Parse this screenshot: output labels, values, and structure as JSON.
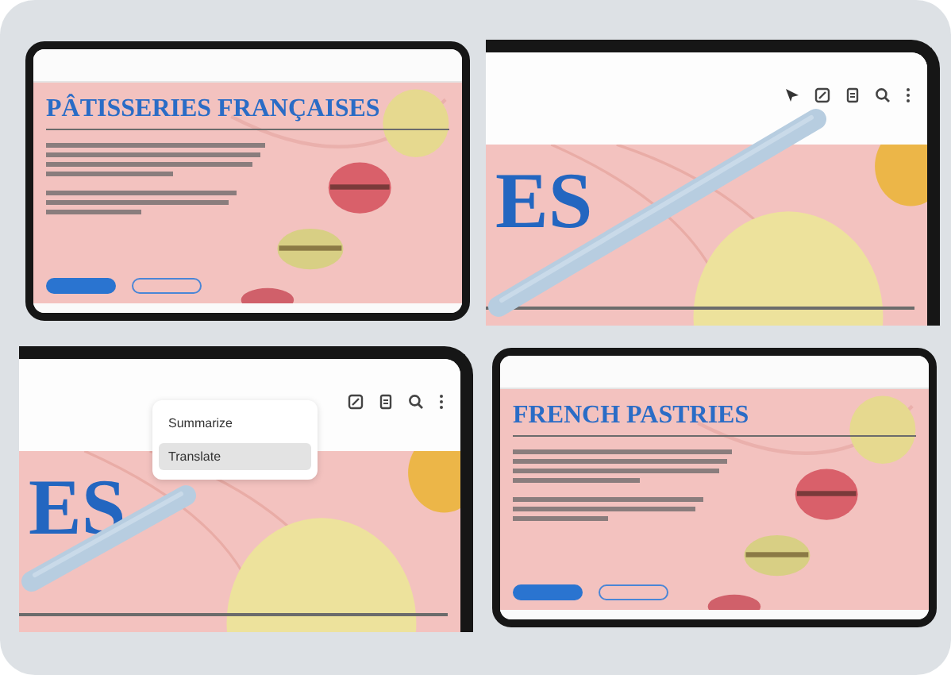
{
  "panels": [
    {
      "kind": "tablet",
      "title": "PÂTISSERIES FRANÇAISES"
    },
    {
      "kind": "corner",
      "title_fragment": "ES",
      "stylus": true
    },
    {
      "kind": "corner",
      "title_fragment": "ES",
      "stylus": true,
      "menu": [
        {
          "label": "Summarize",
          "selected": false
        },
        {
          "label": "Translate",
          "selected": true
        }
      ]
    },
    {
      "kind": "tablet",
      "title": "FRENCH PASTRIES"
    }
  ]
}
